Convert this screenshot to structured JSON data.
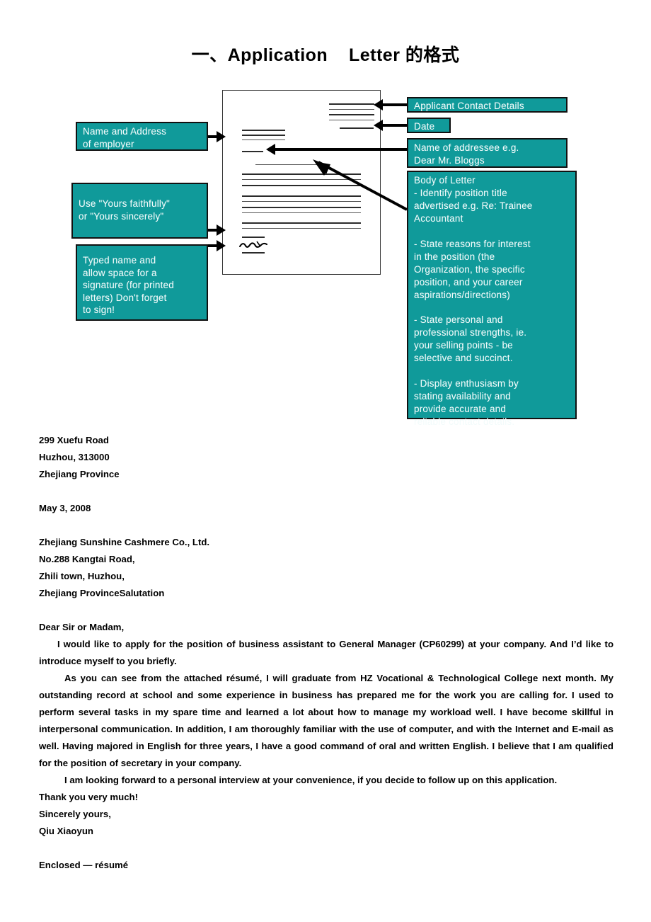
{
  "title": "一、Application    Letter 的格式",
  "colors": {
    "callout_fill": "#109a9a",
    "callout_text": "#f2fbfb",
    "callout_border": "#111111",
    "letter_line": "#2b2b2b",
    "arrow": "#000000"
  },
  "diagram": {
    "left_callouts": [
      {
        "id": "name-address-employer",
        "text": "Name and Address\nof employer"
      },
      {
        "id": "closing-phrase",
        "text": "Use \"Yours faithfully\"\nor \"Yours sincerely\""
      },
      {
        "id": "typed-name-signature",
        "text": "Typed name and\nallow space for a\nsignature (for printed\nletters) Don't forget\nto sign!"
      }
    ],
    "right_callouts": [
      {
        "id": "applicant-contact-details",
        "text": "Applicant Contact Details"
      },
      {
        "id": "date",
        "text": "Date"
      },
      {
        "id": "name-of-addressee",
        "text": "Name of addressee e.g.\nDear Mr. Bloggs"
      },
      {
        "id": "body-of-letter",
        "text": "Body of Letter\n- Identify position title\nadvertised e.g.  Re: Trainee\nAccountant\n\n- State reasons for interest\nin the position (the\nOrganization, the specific\nposition, and your career\naspirations/directions)\n\n- State personal and\nprofessional strengths, ie.\nyour selling points - be\nselective and succinct.\n\n- Display enthusiasm by\nstating availability and\nprovide accurate and\nreliable contact details."
      }
    ],
    "letter_mock": {
      "label": "letter page mock-up",
      "signature_label": "handwritten signature squiggle"
    }
  },
  "letter": {
    "sender_address": [
      "299 Xuefu Road",
      "Huzhou, 313000",
      "Zhejiang Province"
    ],
    "date": "May 3, 2008",
    "recipient_address": [
      "Zhejiang Sunshine Cashmere Co., Ltd.",
      "No.288 Kangtai Road,",
      "Zhili town, Huzhou,",
      "Zhejiang ProvinceSalutation"
    ],
    "salutation": "Dear Sir or Madam,",
    "paragraph_1": "I would like to apply for the position of business assistant to General Manager (CP60299) at your company. And I’d like to introduce myself to you briefly.",
    "paragraph_2": "As you can see from the attached résumé, I will graduate from HZ Vocational & Technological College next month. My outstanding record at school and some experience in business has prepared me for the work you are calling for. I used to perform several tasks in my spare time and learned a lot about how to manage my workload well. I have become skillful in interpersonal communication. In addition, I am thoroughly familiar with the use of computer, and with the Internet and E-mail as well. Having majored in English for three years, I have a good command of oral and written English. I believe that I am qualified for the position of secretary in your company.",
    "paragraph_3": "I am looking forward to a personal interview at your convenience, if you decide to follow up on this application.",
    "thanks": "Thank you very much!",
    "closing": "Sincerely yours,",
    "signature_name": "Qiu Xiaoyun",
    "enclosure": "Enclosed — résumé"
  }
}
